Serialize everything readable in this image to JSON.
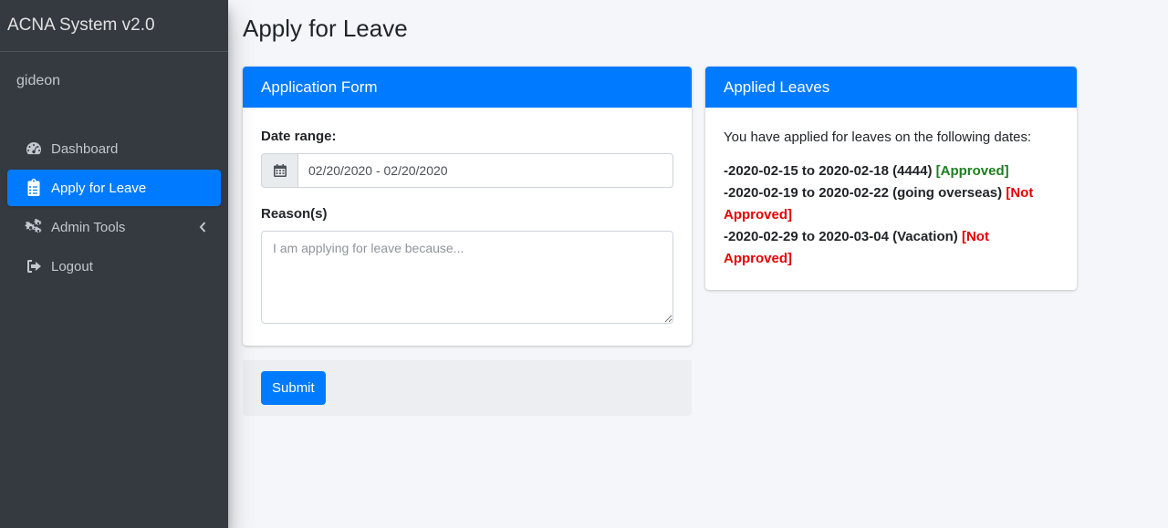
{
  "app": {
    "brand": "ACNA System v2.0",
    "username": "gideon"
  },
  "sidebar": {
    "items": [
      {
        "label": "Dashboard",
        "icon": "tachometer-icon"
      },
      {
        "label": "Apply for Leave",
        "icon": "clipboard-list-icon",
        "active": true
      },
      {
        "label": "Admin Tools",
        "icon": "cogs-icon",
        "has_submenu": true
      },
      {
        "label": "Logout",
        "icon": "sign-out-icon"
      }
    ]
  },
  "page": {
    "title": "Apply for Leave"
  },
  "form_card": {
    "header": "Application Form",
    "date_label": "Date range:",
    "date_value": "02/20/2020 - 02/20/2020",
    "reason_label": "Reason(s)",
    "reason_placeholder": "I am applying for leave because...",
    "submit_label": "Submit"
  },
  "applied_card": {
    "header": "Applied Leaves",
    "intro": "You have applied for leaves on the following dates:",
    "leaves": [
      {
        "range": "-2020-02-15 to 2020-02-18 (4444)",
        "status": "[Approved]"
      },
      {
        "range": "-2020-02-19 to 2020-02-22 (going overseas)",
        "status": "[Not Approved]"
      },
      {
        "range": "-2020-02-29 to 2020-03-04 (Vacation)",
        "status": "[Not Approved]"
      }
    ]
  },
  "colors": {
    "primary": "#007bff",
    "sidebar_bg": "#343a40",
    "approved": "#1e7e1e",
    "not_approved": "#e60000"
  }
}
